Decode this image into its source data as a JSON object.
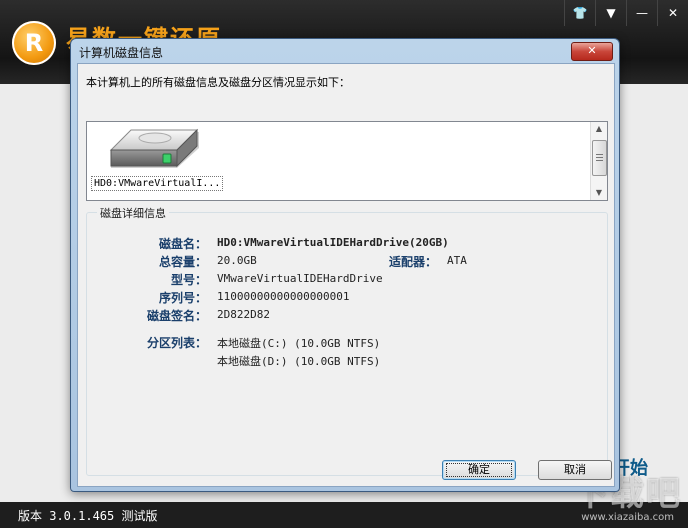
{
  "app": {
    "title": "易数一键还原",
    "logo_glyph": "R",
    "start_label": "开始",
    "version": "版本 3.0.1.465 测试版",
    "window_icons": [
      "shirt-icon",
      "dropdown-icon",
      "minimize-icon",
      "close-icon"
    ],
    "window_glyphs": [
      "👕",
      "▼",
      "—",
      "✕"
    ],
    "watermark": "下载吧",
    "watermark_sub": "www.xiazaiba.com"
  },
  "dialog": {
    "title": "计算机磁盘信息",
    "close_glyph": "✕",
    "description": "本计算机上的所有磁盘信息及磁盘分区情况显示如下：",
    "disks": [
      {
        "label": "HD0:VMwareVirtualI..."
      }
    ],
    "details": {
      "legend": "磁盘详细信息",
      "name_label": "磁盘名：",
      "name_value": "HD0:VMwareVirtualIDEHardDrive(20GB)",
      "capacity_label": "总容量：",
      "capacity_value": "20.0GB",
      "adapter_label": "适配器：",
      "adapter_value": "ATA",
      "model_label": "型号：",
      "model_value": "VMwareVirtualIDEHardDrive",
      "serial_label": "序列号：",
      "serial_value": "11000000000000000001",
      "signature_label": "磁盘签名：",
      "signature_value": "2D822D82",
      "partitions_label": "分区列表：",
      "partitions": [
        "本地磁盘(C:) (10.0GB NTFS)",
        "本地磁盘(D:) (10.0GB NTFS)"
      ]
    },
    "ok_label": "确定",
    "cancel_label": "取消"
  },
  "colors": {
    "accent": "#f6a21a",
    "label_blue": "#1a3f6b",
    "dialog_frame": "#a9c4e0"
  }
}
